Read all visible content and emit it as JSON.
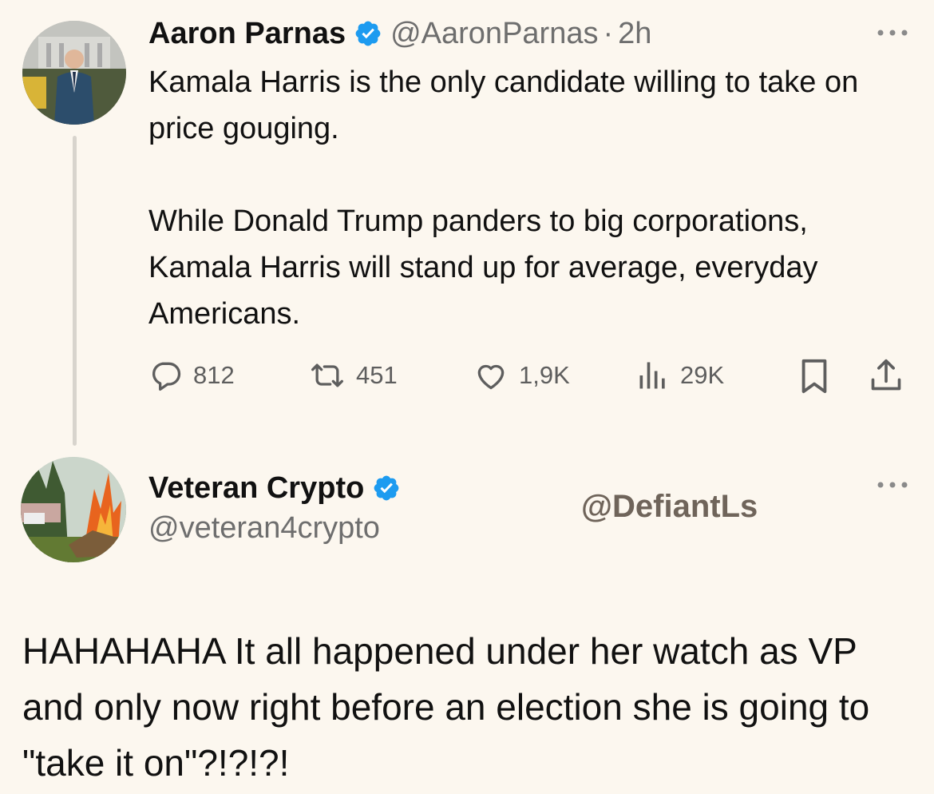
{
  "tweet1": {
    "author_name": "Aaron Parnas",
    "handle": "@AaronParnas",
    "separator": "·",
    "time": "2h",
    "text_lines": [
      "Kamala Harris is the only candidate willing to take on price gouging.",
      "While Donald Trump panders to big corporations, Kamala Harris will stand up for average, everyday Americans."
    ],
    "actions": {
      "replies": "812",
      "reposts": "451",
      "likes": "1,9K",
      "views": "29K"
    },
    "verified_icon": "verified-badge-icon"
  },
  "tweet2": {
    "author_name": "Veteran Crypto",
    "handle": "@veteran4crypto",
    "watermark": "@DefiantLs",
    "text": "HAHAHAHA It all happened under her watch as VP and only now right before an election she is going to \"take it on\"?!?!?!"
  },
  "colors": {
    "background": "#fcf7ef",
    "verified": "#1d9bf0",
    "secondary_text": "#6e6e6e"
  }
}
